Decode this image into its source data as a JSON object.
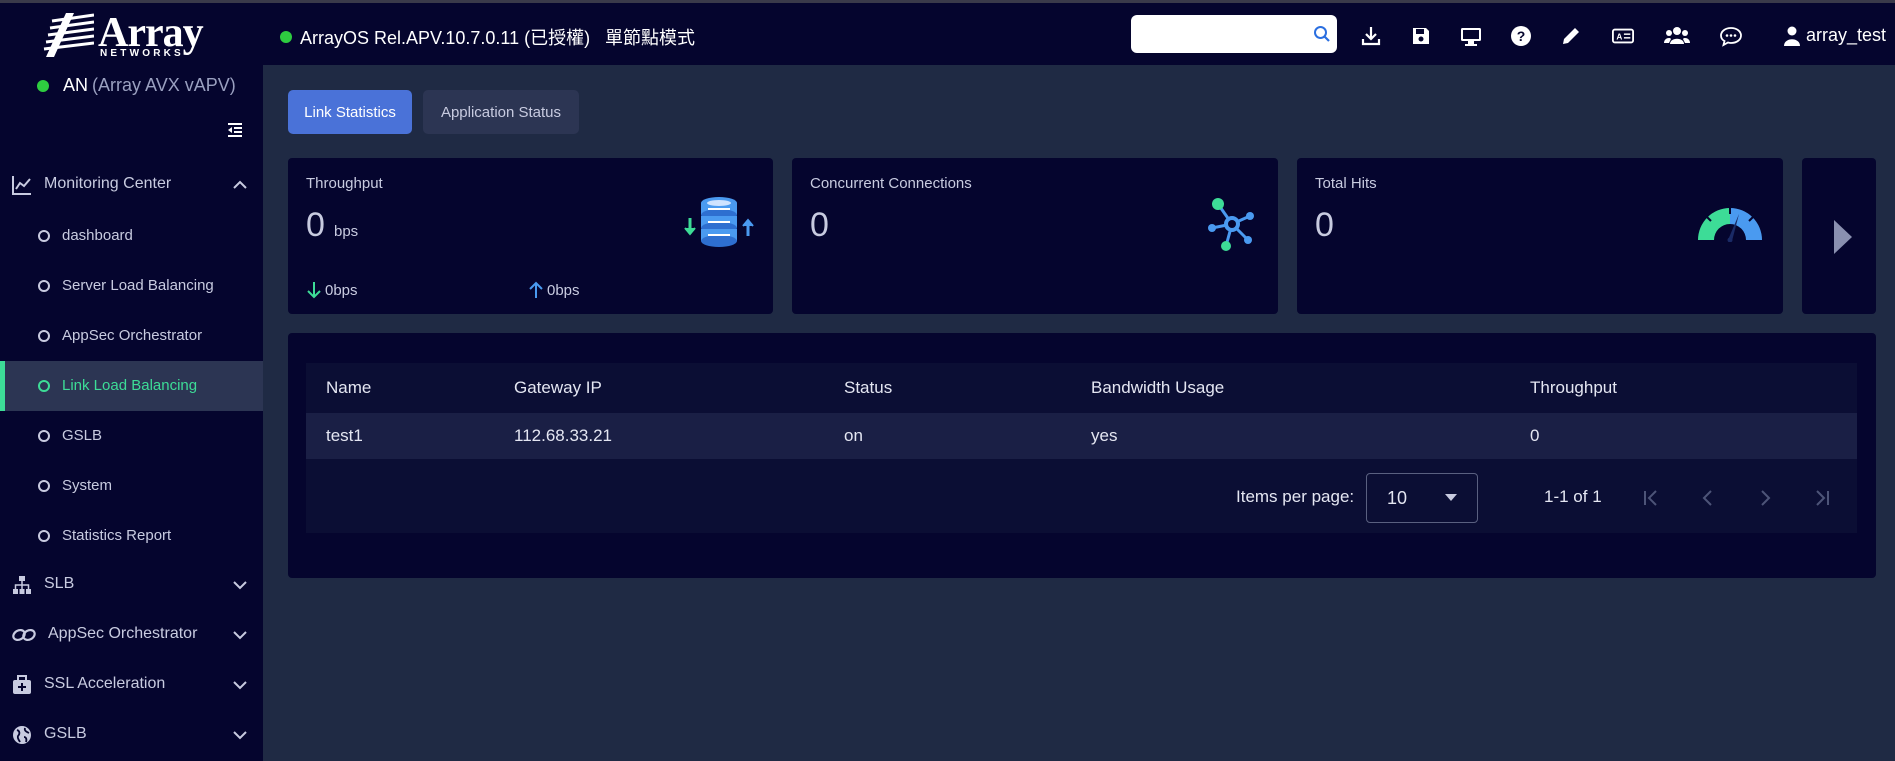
{
  "header": {
    "logo_word": "Array",
    "logo_sub": "NETWORKS",
    "version": "ArrayOS Rel.APV.10.7.0.11 (已授權)",
    "mode": "單節點模式",
    "search_placeholder": "",
    "user": "array_test",
    "icons": [
      "download-icon",
      "save-icon",
      "monitor-icon",
      "help-icon",
      "pen-icon",
      "id-card-icon",
      "users-icon",
      "chat-icon",
      "user-icon"
    ]
  },
  "sidebar": {
    "device_name": "AN",
    "device_sub": "(Array AVX vAPV)",
    "sections": [
      {
        "label": "Monitoring Center",
        "expanded": true
      },
      {
        "label": "SLB",
        "expanded": false
      },
      {
        "label": "AppSec Orchestrator",
        "expanded": false
      },
      {
        "label": "SSL Acceleration",
        "expanded": false
      },
      {
        "label": "GSLB",
        "expanded": false
      }
    ],
    "items": [
      {
        "label": "dashboard"
      },
      {
        "label": "Server Load Balancing"
      },
      {
        "label": "AppSec Orchestrator"
      },
      {
        "label": "Link Load Balancing",
        "active": true
      },
      {
        "label": "GSLB"
      },
      {
        "label": "System"
      },
      {
        "label": "Statistics Report"
      }
    ]
  },
  "tabs": [
    {
      "label": "Link Statistics",
      "active": true
    },
    {
      "label": "Application Status",
      "active": false
    }
  ],
  "cards": {
    "throughput": {
      "title": "Throughput",
      "value": "0",
      "unit": "bps",
      "down": "0bps",
      "up": "0bps"
    },
    "connections": {
      "title": "Concurrent Connections",
      "value": "0"
    },
    "hits": {
      "title": "Total Hits",
      "value": "0"
    }
  },
  "table": {
    "columns": [
      "Name",
      "Gateway IP",
      "Status",
      "Bandwidth Usage",
      "Throughput"
    ],
    "rows": [
      [
        "test1",
        "112.68.33.21",
        "on",
        "yes",
        "0"
      ]
    ],
    "items_per_page_label": "Items per page:",
    "items_per_page": "10",
    "range": "1-1 of 1"
  },
  "colors": {
    "accent": "#4a72d8",
    "active_green": "#3ddc97",
    "status_green": "#2ecc40",
    "nav_bg": "#05052e",
    "page_bg": "#1f2a44"
  }
}
